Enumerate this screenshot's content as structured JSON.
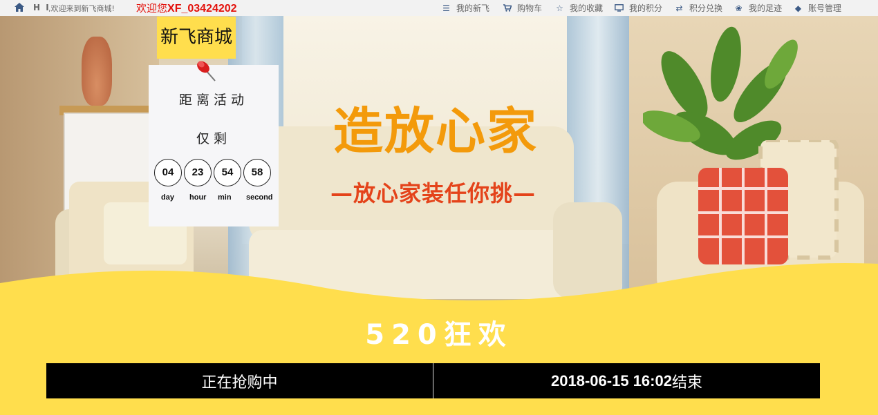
{
  "topbar": {
    "hi": "H I",
    "greeting": ",欢迎来到新飞商城!",
    "welcome_prefix": "欢迎您",
    "username": "XF_03424202",
    "nav": [
      {
        "icon": "list-icon",
        "glyph": "☰",
        "label": "我的新飞"
      },
      {
        "icon": "cart-icon",
        "glyph": "🛒",
        "label": "购物车"
      },
      {
        "icon": "star-icon",
        "glyph": "☆",
        "label": "我的收藏"
      },
      {
        "icon": "monitor-icon",
        "glyph": "▭",
        "label": "我的积分"
      },
      {
        "icon": "exchange-icon",
        "glyph": "⇄",
        "label": "积分兑换"
      },
      {
        "icon": "paw-icon",
        "glyph": "❀",
        "label": "我的足迹"
      },
      {
        "icon": "tag-icon",
        "glyph": "◆",
        "label": "账号管理"
      }
    ]
  },
  "brand": {
    "name": "新飞商城"
  },
  "countdown": {
    "title_1": "距离活动",
    "title_2": "仅剩",
    "days": "04",
    "hours": "23",
    "minutes": "54",
    "seconds": "58",
    "unit_day": "day",
    "unit_hour": "hour",
    "unit_min": "min",
    "unit_second": "second"
  },
  "banner": {
    "headline": "造放心家",
    "subline": "—放心家装任你挑—"
  },
  "promo": {
    "festival": "520狂欢",
    "status": "正在抢购中",
    "end_time": "2018-06-15 16:02",
    "end_suffix": "结束"
  },
  "colors": {
    "accent_yellow": "#ffde4d",
    "headline_orange": "#f39a0b",
    "subline_red": "#e4431a",
    "welcome_red": "#e3110b",
    "nav_icon_blue": "#3c5a85"
  }
}
